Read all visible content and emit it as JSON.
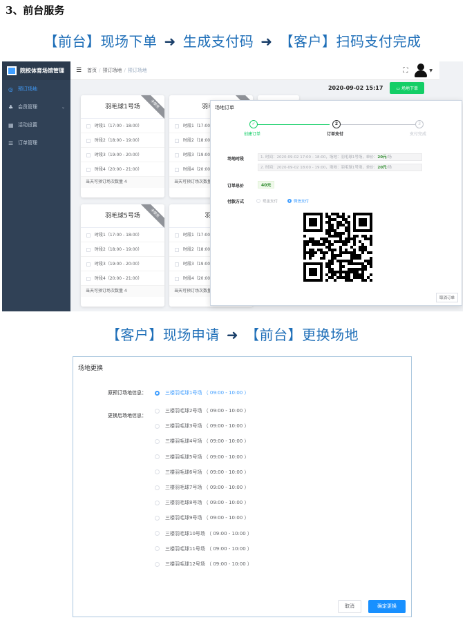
{
  "heading": "3、前台服务",
  "flow1": {
    "step1": "【前台】现场下单",
    "step2": "生成支付码",
    "step3": "【客户】扫码支付完成",
    "arrow": "➜"
  },
  "flow2": {
    "step1": "【客户】现场申请",
    "step2": "【前台】更换场地",
    "arrow": "➜"
  },
  "app": {
    "title": "院校体育场馆管理",
    "nav": [
      {
        "label": "预订场地",
        "icon": "circle-icon",
        "active": true
      },
      {
        "label": "会员管理",
        "icon": "users-icon",
        "active": false
      },
      {
        "label": "活动设置",
        "icon": "grid-icon",
        "active": false
      },
      {
        "label": "订单管理",
        "icon": "list-icon",
        "active": false
      }
    ],
    "breadcrumb": [
      "首页",
      "预订场地",
      "预订场地"
    ],
    "clock": "2020-09-02 15:17",
    "order_button": "场地下单",
    "cards": [
      {
        "title": "羽毛球1号场",
        "ribbon": "未使用"
      },
      {
        "title": "羽毛球",
        "ribbon": ""
      },
      {
        "title": "羽毛球5号场",
        "ribbon": "未使用"
      },
      {
        "title": "羽毛",
        "ribbon": ""
      }
    ],
    "slots": [
      "时段1（17:00 - 18:00）",
      "时段2（18:00 - 19:00）",
      "时段3（19:00 - 20:00）",
      "时段4（20:00 - 21:00）"
    ],
    "slots_clip": [
      "时段1（17:00",
      "时段2（18:00",
      "时段3（19:00",
      "时段4（20:00"
    ],
    "card_footer": "当天可预订场次数量 4",
    "card_footer_clip": "当天可预订场次数量"
  },
  "order_modal": {
    "title": "场地订单",
    "steps": [
      "创建订单",
      "订单支付",
      "支付完成"
    ],
    "step_numbers": [
      "✓",
      "2",
      "3"
    ],
    "time_label": "场地时段",
    "times": [
      {
        "text": "1. 时间：2020-09-02 17:00 - 18:00，场地：羽毛球1号场，单价：",
        "price": "20元",
        "unit": "/场"
      },
      {
        "text": "2. 时间：2020-09-02 18:00 - 19:00，场地：羽毛球1号场，单价：",
        "price": "20元",
        "unit": "/场"
      }
    ],
    "total_label": "订单总价",
    "total": "40元",
    "pay_label": "付款方式",
    "pay_options": [
      "现金支付",
      "微信支付"
    ],
    "cancel": "取消订单"
  },
  "change_modal": {
    "title": "场地更换",
    "original_label": "原预订场地信息：",
    "original": "三楼羽毛球1号场 （ 09:00 - 10:00 ）",
    "new_label": "更换后场地信息：",
    "options": [
      "三楼羽毛球2号场 （ 09:00 - 10:00 ）",
      "三楼羽毛球3号场 （ 09:00 - 10:00 ）",
      "三楼羽毛球4号场 （ 09:00 - 10:00 ）",
      "三楼羽毛球5号场 （ 09:00 - 10:00 ）",
      "三楼羽毛球6号场 （ 09:00 - 10:00 ）",
      "三楼羽毛球7号场 （ 09:00 - 10:00 ）",
      "三楼羽毛球8号场 （ 09:00 - 10:00 ）",
      "三楼羽毛球9号场 （ 09:00 - 10:00 ）",
      "三楼羽毛球10号场 （ 09:00 - 10:00 ）",
      "三楼羽毛球11号场 （ 09:00 - 10:00 ）",
      "三楼羽毛球12号场 （ 09:00 - 10:00 ）"
    ],
    "cancel": "取消",
    "confirm": "确定更换"
  },
  "colors": {
    "caption": "#1f6fb8",
    "primary": "#409eff",
    "success": "#13ce66",
    "sidebar": "#304156"
  }
}
